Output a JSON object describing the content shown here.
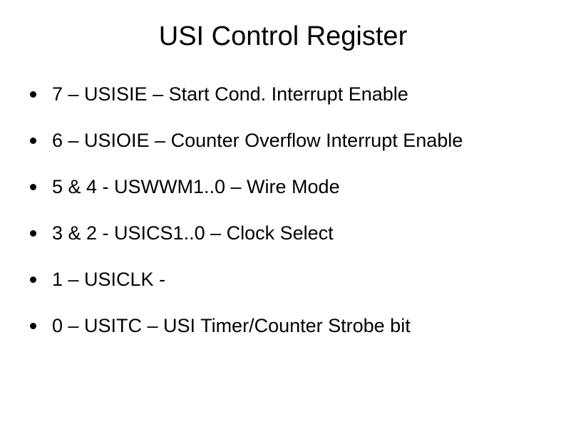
{
  "slide": {
    "title": "USI Control Register",
    "bullets": [
      "7 – USISIE – Start Cond. Interrupt Enable",
      "6 – USIOIE – Counter Overflow Interrupt Enable",
      "5 & 4 - USWWM1..0 – Wire Mode",
      "3 & 2 - USICS1..0 – Clock Select",
      "1 – USICLK -",
      "0 – USITC – USI Timer/Counter Strobe bit"
    ]
  }
}
